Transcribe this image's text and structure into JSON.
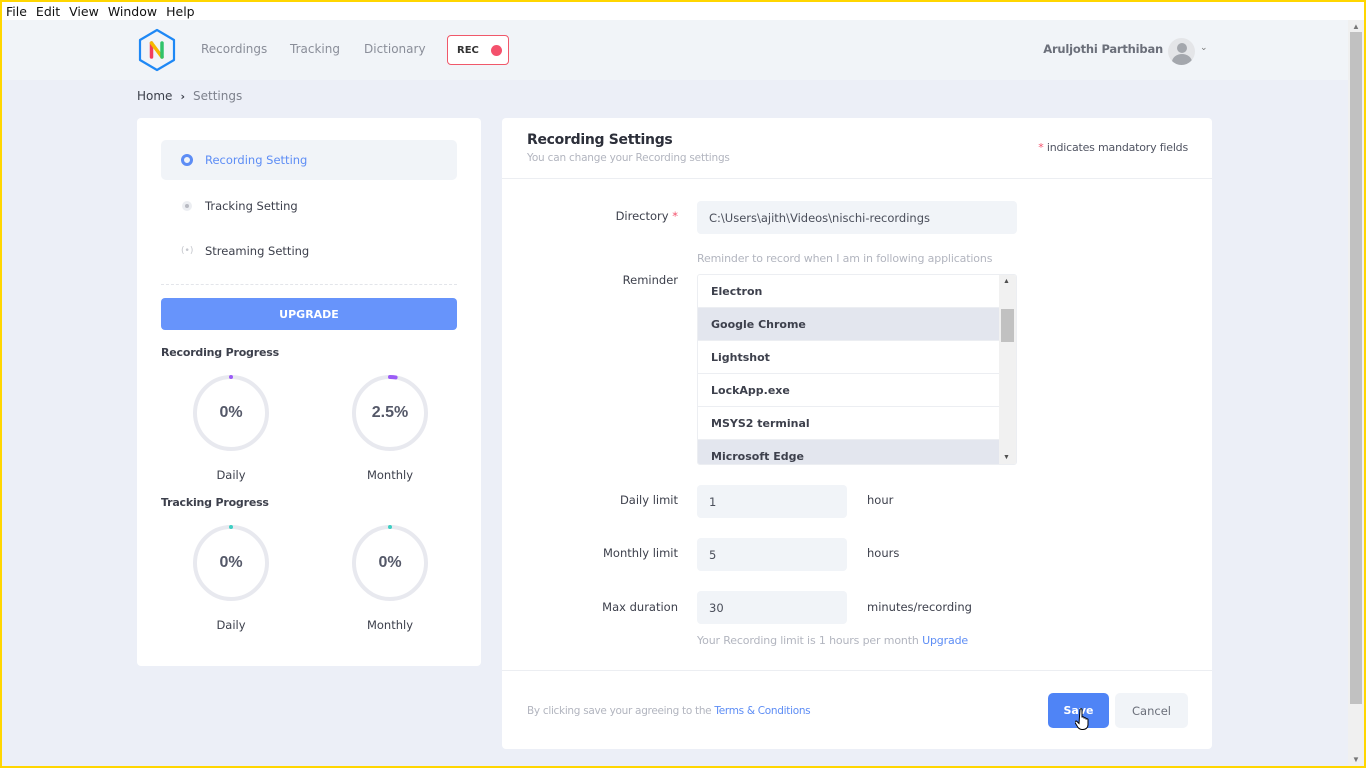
{
  "menubar": [
    "File",
    "Edit",
    "View",
    "Window",
    "Help"
  ],
  "header": {
    "nav": [
      "Recordings",
      "Tracking",
      "Dictionary"
    ],
    "rec_label": "REC",
    "user_name": "Aruljothi Parthiban"
  },
  "breadcrumb": {
    "home": "Home",
    "separator": "›",
    "current": "Settings"
  },
  "sidebar": {
    "items": [
      {
        "label": "Recording Setting",
        "icon": "record-ring-icon",
        "active": true
      },
      {
        "label": "Tracking Setting",
        "icon": "gear-icon",
        "active": false
      },
      {
        "label": "Streaming Setting",
        "icon": "broadcast-icon",
        "active": false
      }
    ],
    "upgrade_label": "UPGRADE",
    "recording_progress": {
      "title": "Recording Progress",
      "color": "#9b5cf6",
      "daily": {
        "label": "Daily",
        "text": "0%",
        "percent": 0
      },
      "monthly": {
        "label": "Monthly",
        "text": "2.5%",
        "percent": 2.5
      }
    },
    "tracking_progress": {
      "title": "Tracking Progress",
      "color": "#3ecfc3",
      "daily": {
        "label": "Daily",
        "text": "0%",
        "percent": 0
      },
      "monthly": {
        "label": "Monthly",
        "text": "0%",
        "percent": 0
      }
    }
  },
  "main": {
    "title": "Recording Settings",
    "subtitle": "You can change your Recording settings",
    "mandatory_star": "*",
    "mandatory_note": " indicates mandatory fields",
    "directory": {
      "label": "Directory",
      "value": "C:\\Users\\ajith\\Videos\\nischi-recordings"
    },
    "reminder": {
      "label": "Reminder",
      "hint": "Reminder to record when I am in following applications",
      "apps": [
        {
          "name": "Electron",
          "selected": false
        },
        {
          "name": "Google Chrome",
          "selected": true
        },
        {
          "name": "Lightshot",
          "selected": false
        },
        {
          "name": "LockApp.exe",
          "selected": false
        },
        {
          "name": "MSYS2 terminal",
          "selected": false
        },
        {
          "name": "Microsoft Edge",
          "selected": true
        }
      ]
    },
    "daily_limit": {
      "label": "Daily limit",
      "value": "1",
      "unit": "hour"
    },
    "monthly_limit": {
      "label": "Monthly limit",
      "value": "5",
      "unit": "hours"
    },
    "max_duration": {
      "label": "Max duration",
      "value": "30",
      "unit": "minutes/recording"
    },
    "limit_note": "Your Recording limit is 1 hours per month ",
    "limit_link": "Upgrade",
    "terms_prefix": "By clicking save your agreeing to the ",
    "terms_link": "Terms & Conditions",
    "save_label": "Save",
    "cancel_label": "Cancel"
  }
}
